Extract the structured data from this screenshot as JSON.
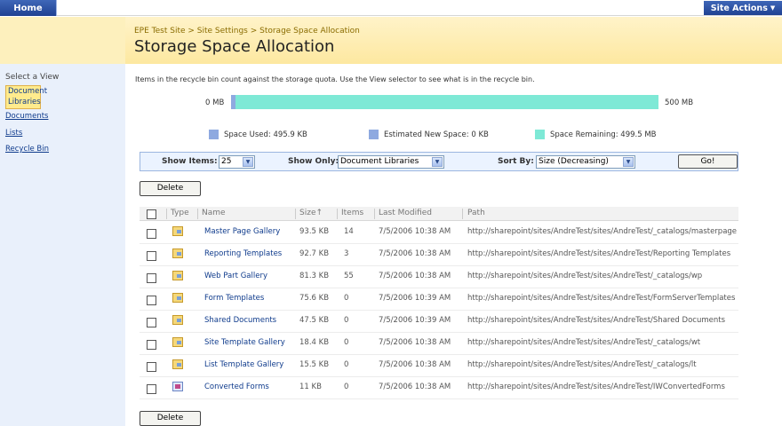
{
  "topbar": {
    "home_label": "Home",
    "site_actions_label": "Site Actions"
  },
  "header": {
    "breadcrumb": "EPE Test Site > Site Settings > Storage Space Allocation",
    "title": "Storage Space Allocation"
  },
  "leftnav": {
    "select_view_label": "Select a View",
    "selected_item_line1": "Document",
    "selected_item_line2": "Libraries",
    "links": [
      "Documents",
      "Lists",
      "Recycle Bin"
    ]
  },
  "main": {
    "description": "Items in the recycle bin count against the storage quota. Use the View selector to see what is in the recycle bin.",
    "quota": {
      "min_label": "0 MB",
      "max_label": "500 MB",
      "used_fraction": 0.01,
      "used_color": "#8ea9e0",
      "remaining_color": "#7ee9d6"
    },
    "legend": {
      "used": "Space Used:  495.9 KB",
      "estimated": "Estimated New Space:  0 KB",
      "remaining": "Space Remaining:  499.5 MB"
    },
    "toolbar": {
      "show_items_label": "Show Items:",
      "show_items_value": "25",
      "show_only_label": "Show Only:",
      "show_only_value": "Document Libraries",
      "sort_by_label": "Sort By:",
      "sort_by_value": "Size (Decreasing)",
      "go_label": "Go!"
    },
    "delete_label": "Delete",
    "columns": {
      "type": "Type",
      "name": "Name",
      "size": "Size↑",
      "items": "Items",
      "last_modified": "Last Modified",
      "path": "Path"
    },
    "rows": [
      {
        "icon": "folder-icon",
        "name": "Master Page Gallery",
        "size": "93.5 KB",
        "items": "14",
        "modified": "7/5/2006 10:38 AM",
        "path": "http://sharepoint/sites/AndreTest/sites/AndreTest/_catalogs/masterpage"
      },
      {
        "icon": "folder-icon",
        "name": "Reporting Templates",
        "size": "92.7 KB",
        "items": "3",
        "modified": "7/5/2006 10:38 AM",
        "path": "http://sharepoint/sites/AndreTest/sites/AndreTest/Reporting Templates"
      },
      {
        "icon": "folder-icon",
        "name": "Web Part Gallery",
        "size": "81.3 KB",
        "items": "55",
        "modified": "7/5/2006 10:38 AM",
        "path": "http://sharepoint/sites/AndreTest/sites/AndreTest/_catalogs/wp"
      },
      {
        "icon": "folder-icon",
        "name": "Form Templates",
        "size": "75.6 KB",
        "items": "0",
        "modified": "7/5/2006 10:39 AM",
        "path": "http://sharepoint/sites/AndreTest/sites/AndreTest/FormServerTemplates"
      },
      {
        "icon": "folder-icon",
        "name": "Shared Documents",
        "size": "47.5 KB",
        "items": "0",
        "modified": "7/5/2006 10:39 AM",
        "path": "http://sharepoint/sites/AndreTest/sites/AndreTest/Shared Documents"
      },
      {
        "icon": "folder-icon",
        "name": "Site Template Gallery",
        "size": "18.4 KB",
        "items": "0",
        "modified": "7/5/2006 10:38 AM",
        "path": "http://sharepoint/sites/AndreTest/sites/AndreTest/_catalogs/wt"
      },
      {
        "icon": "folder-icon",
        "name": "List Template Gallery",
        "size": "15.5 KB",
        "items": "0",
        "modified": "7/5/2006 10:38 AM",
        "path": "http://sharepoint/sites/AndreTest/sites/AndreTest/_catalogs/lt"
      },
      {
        "icon": "form-icon",
        "name": "Converted Forms",
        "size": "11 KB",
        "items": "0",
        "modified": "7/5/2006 10:38 AM",
        "path": "http://sharepoint/sites/AndreTest/sites/AndreTest/IWConvertedForms"
      }
    ]
  }
}
